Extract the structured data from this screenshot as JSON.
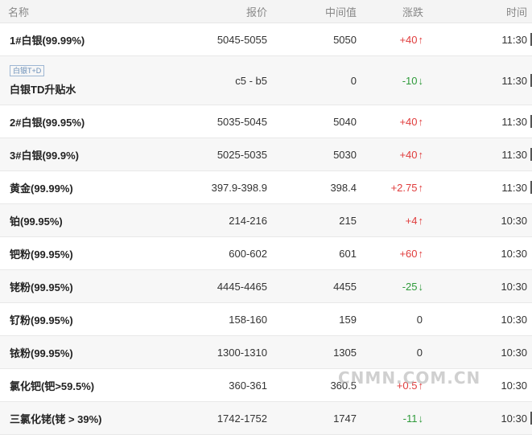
{
  "columns": {
    "name": "名称",
    "quote": "报价",
    "mid": "中间值",
    "change": "涨跌",
    "time": "时间"
  },
  "rows": [
    {
      "name": "1#白银(99.99%)",
      "quote": "5045-5055",
      "mid": "5050",
      "change": "+40",
      "dir": "up",
      "time": "11:30"
    },
    {
      "badge": "白银T+D",
      "name": "白银TD升贴水",
      "quote": "c5 - b5",
      "mid": "0",
      "change": "-10",
      "dir": "down",
      "time": "11:30"
    },
    {
      "name": "2#白银(99.95%)",
      "quote": "5035-5045",
      "mid": "5040",
      "change": "+40",
      "dir": "up",
      "time": "11:30"
    },
    {
      "name": "3#白银(99.9%)",
      "quote": "5025-5035",
      "mid": "5030",
      "change": "+40",
      "dir": "up",
      "time": "11:30"
    },
    {
      "name": "黄金(99.99%)",
      "quote": "397.9-398.9",
      "mid": "398.4",
      "change": "+2.75",
      "dir": "up",
      "time": "11:30"
    },
    {
      "name": "铂(99.95%)",
      "quote": "214-216",
      "mid": "215",
      "change": "+4",
      "dir": "up",
      "time": "10:30"
    },
    {
      "name": "钯粉(99.95%)",
      "quote": "600-602",
      "mid": "601",
      "change": "+60",
      "dir": "up",
      "time": "10:30"
    },
    {
      "name": "铑粉(99.95%)",
      "quote": "4445-4465",
      "mid": "4455",
      "change": "-25",
      "dir": "down",
      "time": "10:30"
    },
    {
      "name": "钌粉(99.95%)",
      "quote": "158-160",
      "mid": "159",
      "change": "0",
      "dir": "flat",
      "time": "10:30"
    },
    {
      "name": "铱粉(99.95%)",
      "quote": "1300-1310",
      "mid": "1305",
      "change": "0",
      "dir": "flat",
      "time": "10:30"
    },
    {
      "name": "氯化钯(钯>59.5%)",
      "quote": "360-361",
      "mid": "360.5",
      "change": "+0.5",
      "dir": "up",
      "time": "10:30"
    },
    {
      "name": "三氯化铑(铑 > 39%)",
      "quote": "1742-1752",
      "mid": "1747",
      "change": "-11",
      "dir": "down",
      "time": "10:30"
    }
  ],
  "arrows": {
    "up": "↑",
    "down": "↓",
    "flat": ""
  },
  "watermark": "CNMN.COM.CN"
}
